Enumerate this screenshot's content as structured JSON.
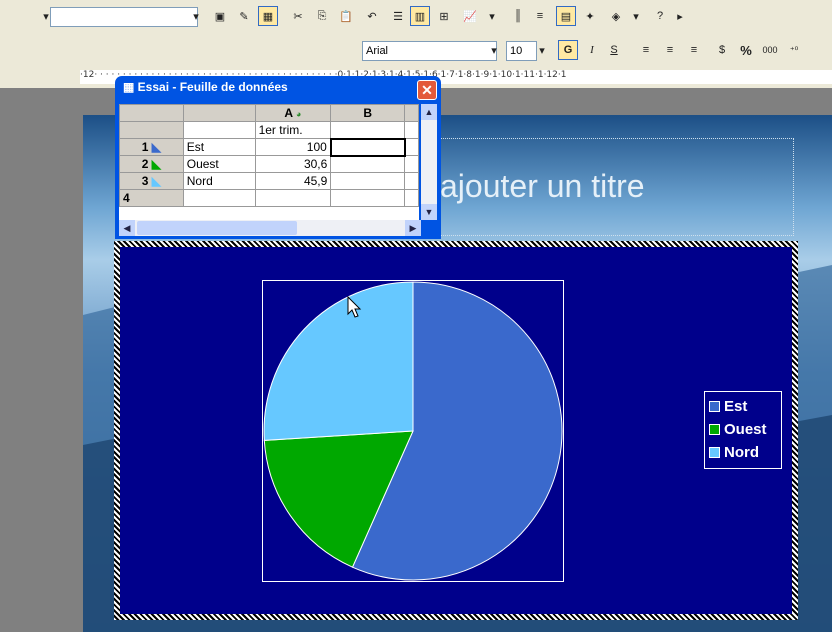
{
  "toolbar": {
    "font_name": "Arial",
    "font_size": "10",
    "bold_label": "G",
    "italic_label": "I",
    "underline_label": "S",
    "percent_label": "%",
    "thousands_label": "000"
  },
  "ruler": {
    "text": "·12·  · · · · · · · · · · · · · · · · · · · · · · · · · · · · · · · · · · · · · · · · · ·0·1·1·2·1·3·1·4·1·5·1·6·1·7·1·8·1·9·1·10·1·11·1·12·1"
  },
  "slide": {
    "title_placeholder": "ajouter un titre"
  },
  "datasheet": {
    "window_title": "Essai - Feuille de données",
    "columns": [
      "A",
      "B"
    ],
    "header_row": "1er trim.",
    "rows": [
      {
        "num": "1",
        "label": "Est",
        "value": "100"
      },
      {
        "num": "2",
        "label": "Ouest",
        "value": "30,6"
      },
      {
        "num": "3",
        "label": "Nord",
        "value": "45,9"
      },
      {
        "num": "4",
        "label": "",
        "value": ""
      }
    ]
  },
  "chart_data": {
    "type": "pie",
    "categories": [
      "Est",
      "Ouest",
      "Nord"
    ],
    "values": [
      100,
      30.6,
      45.9
    ],
    "colors": [
      "#3a69cc",
      "#00a800",
      "#66c8ff"
    ],
    "legend": "right"
  }
}
